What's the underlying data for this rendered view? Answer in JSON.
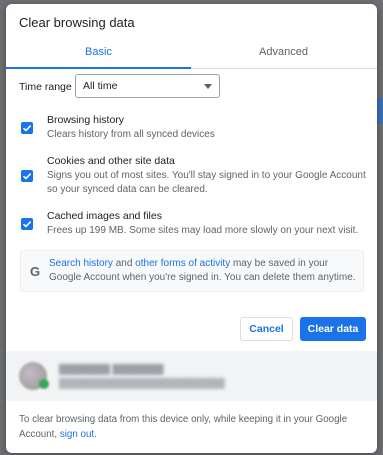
{
  "dialog": {
    "title": "Clear browsing data",
    "tabs": [
      {
        "label": "Basic",
        "selected": true
      },
      {
        "label": "Advanced",
        "selected": false
      }
    ],
    "time_range": {
      "label": "Time range",
      "value": "All time"
    },
    "options": [
      {
        "title": "Browsing history",
        "description": "Clears history from all synced devices",
        "checked": true
      },
      {
        "title": "Cookies and other site data",
        "description": "Signs you out of most sites. You'll stay signed in to your Google Account so your synced data can be cleared.",
        "checked": true
      },
      {
        "title": "Cached images and files",
        "description": "Frees up 199 MB. Some sites may load more slowly on your next visit.",
        "checked": true
      }
    ],
    "info": {
      "icon": "google-g-icon",
      "link1": "Search history",
      "between": " and ",
      "link2": "other forms of activity",
      "rest": " may be saved in your Google Account when you're signed in. You can delete them anytime."
    },
    "buttons": {
      "cancel": "Cancel",
      "clear": "Clear data"
    },
    "footer": {
      "text": "To clear browsing data from this device only, while keeping it in your Google Account, ",
      "link": "sign out",
      "end": "."
    }
  },
  "colors": {
    "accent": "#1a73e8",
    "text_primary": "#202124",
    "text_secondary": "#5f6368"
  }
}
